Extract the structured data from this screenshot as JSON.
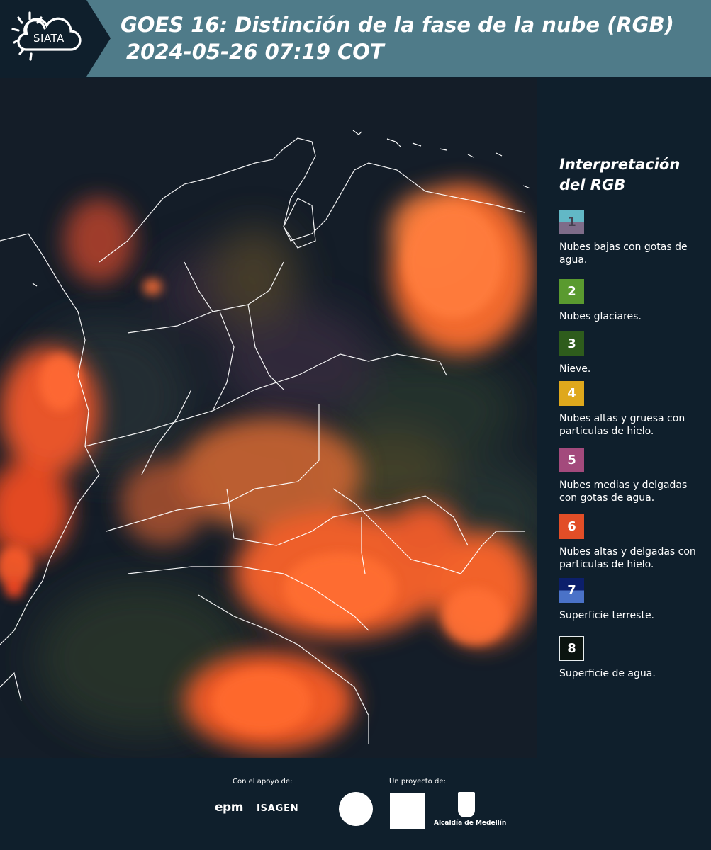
{
  "header": {
    "logo_text": "SIATA",
    "title_line1": "GOES 16: Distinción de la fase de la nube (RGB)",
    "title_line2": "2024-05-26 07:19 COT"
  },
  "legend": {
    "title_line1": "Interpretación",
    "title_line2": "del RGB",
    "items": [
      {
        "number": "1",
        "label": "Nubes bajas con gotas de agua.",
        "color_top": "#62b8c6",
        "color_bottom": "#7e6c89"
      },
      {
        "number": "2",
        "label": "Nubes glaciares.",
        "color_top": "#5a9a2f",
        "color_bottom": "#5a9a2f"
      },
      {
        "number": "3",
        "label": "Nieve.",
        "color_top": "#2e5c1c",
        "color_bottom": "#2e5c1c"
      },
      {
        "number": "4",
        "label": "Nubes altas y gruesa con particulas de hielo.",
        "color_top": "#dfa81c",
        "color_bottom": "#dfa81c"
      },
      {
        "number": "5",
        "label": "Nubes medias y delgadas con gotas de agua.",
        "color_top": "#a34a7c",
        "color_bottom": "#a34a7c"
      },
      {
        "number": "6",
        "label": "Nubes altas y delgadas con particulas de hielo.",
        "color_top": "#e24e27",
        "color_bottom": "#e24e27"
      },
      {
        "number": "7",
        "label": "Superficie terreste.",
        "color_top": "#0c1f6b",
        "color_bottom": "#4a72c8"
      },
      {
        "number": "8",
        "label": "Superficie de agua.",
        "color_top": "#0b140f",
        "color_bottom": "#0b140f"
      }
    ]
  },
  "footer": {
    "support_label": "Con el apoyo de:",
    "project_label": "Un proyecto de:",
    "epm": "epm",
    "isagen": "ISAGEN",
    "alcaldia": "Alcaldía de Medellín"
  }
}
